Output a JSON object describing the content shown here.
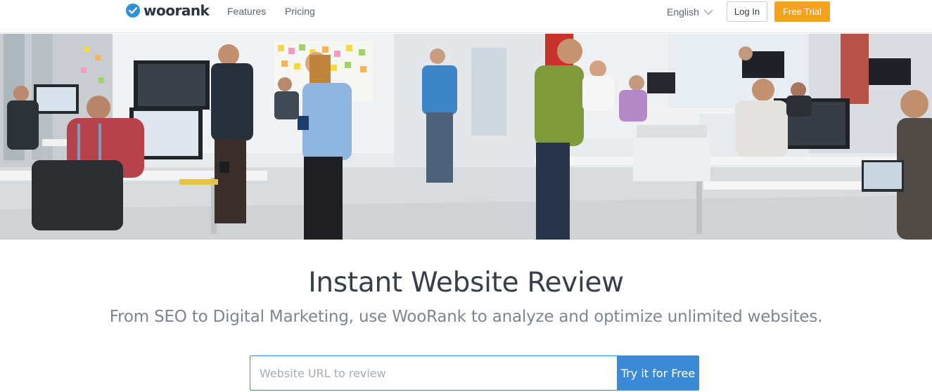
{
  "header": {
    "logo_text": "woorank",
    "nav": {
      "features": "Features",
      "pricing": "Pricing"
    },
    "language": "English",
    "login_label": "Log In",
    "trial_label": "Free Trial"
  },
  "hero": {
    "image_alt": "Team working at desks in an open office"
  },
  "main": {
    "headline": "Instant Website Review",
    "subheadline": "From SEO to Digital Marketing, use WooRank to analyze and optimize unlimited websites.",
    "search": {
      "placeholder": "Website URL to review",
      "value": "",
      "button_label": "Try it for Free"
    }
  },
  "colors": {
    "brand_blue": "#3a8ad6",
    "accent_orange": "#f7a21b",
    "logo_blue": "#2f8fd8"
  }
}
